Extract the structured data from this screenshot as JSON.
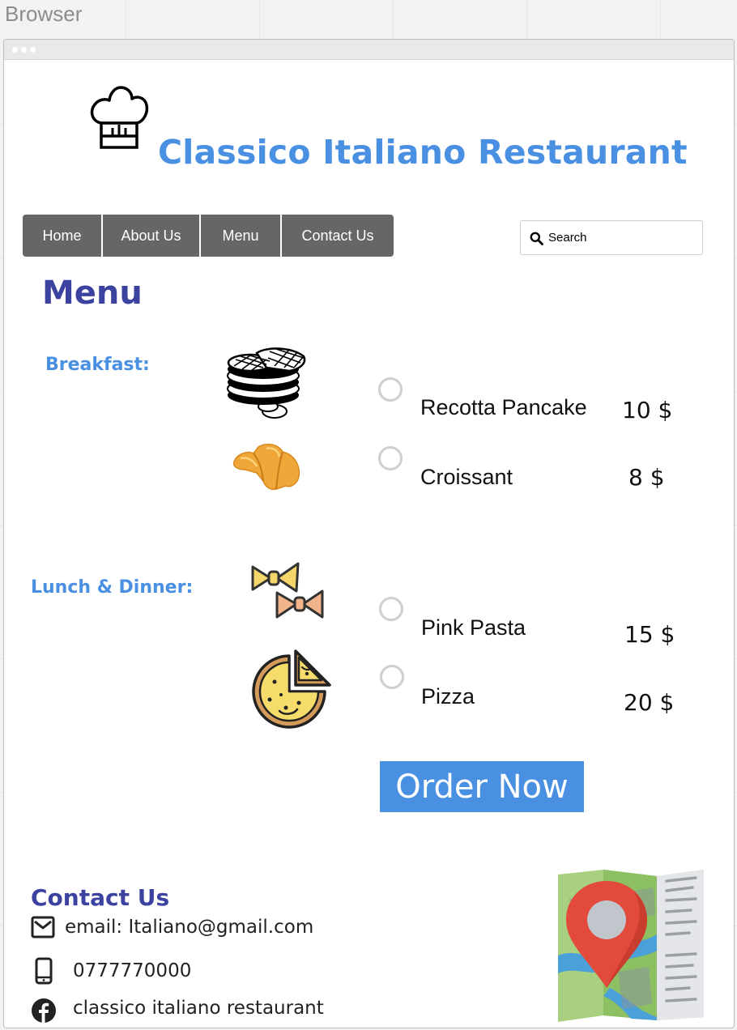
{
  "canvas_label": "Browser",
  "site": {
    "title": "Classico Italiano Restaurant",
    "title_color": "#4a90e2"
  },
  "nav": {
    "items": [
      {
        "label": "Home"
      },
      {
        "label": "About Us"
      },
      {
        "label": "Menu"
      },
      {
        "label": "Contact Us"
      }
    ],
    "bg_color": "#666666"
  },
  "search": {
    "placeholder": "Search"
  },
  "menu": {
    "heading": "Menu",
    "categories": [
      {
        "label": "Breakfast:",
        "items": [
          {
            "name": "Recotta Pancake",
            "price": "10 $",
            "icon": "pancake-icon"
          },
          {
            "name": "Croissant",
            "price": "8 $",
            "icon": "croissant-icon"
          }
        ]
      },
      {
        "label": "Lunch & Dinner:",
        "items": [
          {
            "name": "Pink Pasta",
            "price": "15 $",
            "icon": "pasta-icon"
          },
          {
            "name": "Pizza",
            "price": "20 $",
            "icon": "pizza-icon"
          }
        ]
      }
    ]
  },
  "order_button": {
    "label": "Order Now",
    "color": "#4a90e2"
  },
  "contact": {
    "heading": "Contact Us",
    "email": "email: Italiano@gmail.com",
    "phone": "0777770000",
    "facebook": "classico italiano restaurant"
  }
}
